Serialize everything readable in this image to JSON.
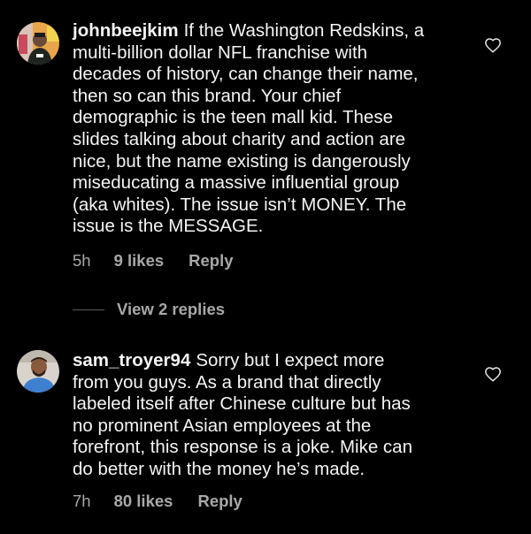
{
  "comments": [
    {
      "username": "johnbeejkim",
      "text": "If the Washington Redskins, a\nmulti-billion dollar NFL franchise with\ndecades of history, can change their name,\nthen so can this brand. Your chief\ndemographic is the teen mall kid. These\nslides talking about charity and action are\nnice, but the name existing is dangerously\nmiseducating a massive influential group\n(aka whites). The issue isn’t MONEY. The\nissue is the MESSAGE.",
      "time": "5h",
      "likes": "9 likes",
      "reply_label": "Reply",
      "view_replies": "View 2 replies",
      "avatar_icon": "profile-photo-person-orange-background"
    },
    {
      "username": "sam_troyer94",
      "text": "Sorry but I expect more\nfrom you guys. As a brand that directly\nlabeled itself after Chinese culture but has\nno prominent Asian employees at the\nforefront, this response is a joke. Mike can\ndo better with the money he’s made.",
      "time": "7h",
      "likes": "80 likes",
      "reply_label": "Reply",
      "avatar_icon": "profile-photo-person-blue-shirt"
    }
  ],
  "colors": {
    "background": "#000000",
    "text_primary": "#f5f5f5",
    "text_secondary": "#a8a8a8"
  },
  "icons": {
    "like": "heart-outline-icon"
  }
}
